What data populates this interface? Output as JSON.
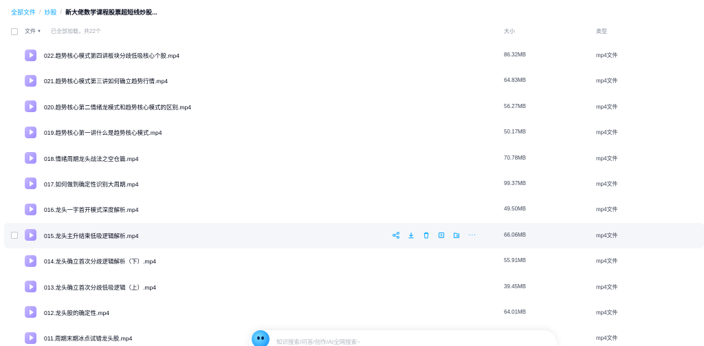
{
  "breadcrumb": {
    "items": [
      "全部文件",
      "炒股"
    ],
    "current": "新大佬数学课程股票超短线炒股...",
    "separator": "/"
  },
  "header": {
    "name_label": "文件",
    "loaded_text": "已全部加载，共22个",
    "size_label": "大小",
    "type_label": "类型"
  },
  "files": [
    {
      "name": "022.趋势核心模式第四讲板块分歧低吸核心个股.mp4",
      "size": "86.32MB",
      "type": "mp4文件"
    },
    {
      "name": "021.趋势核心模式第三讲如何确立趋势行情.mp4",
      "size": "64.83MB",
      "type": "mp4文件"
    },
    {
      "name": "020.趋势核心第二情绪龙模式和趋势核心模式的区别.mp4",
      "size": "56.27MB",
      "type": "mp4文件"
    },
    {
      "name": "019.趋势核心第一讲什么是趋势核心模式.mp4",
      "size": "50.17MB",
      "type": "mp4文件"
    },
    {
      "name": "018.情绪周期龙头战法之空仓篇.mp4",
      "size": "70.78MB",
      "type": "mp4文件"
    },
    {
      "name": "017.如何做到确定性识别大周期.mp4",
      "size": "99.37MB",
      "type": "mp4文件"
    },
    {
      "name": "016.龙头一字首开模式深度解析.mp4",
      "size": "49.50MB",
      "type": "mp4文件"
    },
    {
      "name": "015.龙头主升结束低吸逻辑解析.mp4",
      "size": "66.06MB",
      "type": "mp4文件"
    },
    {
      "name": "014.龙头确立首次分歧逻辑解析（下）.mp4",
      "size": "55.91MB",
      "type": "mp4文件"
    },
    {
      "name": "013.龙头确立首次分歧低吸逻辑（上）.mp4",
      "size": "39.45MB",
      "type": "mp4文件"
    },
    {
      "name": "012.龙头股的确定性.mp4",
      "size": "64.01MB",
      "type": "mp4文件"
    },
    {
      "name": "011.周期末期冰点试错龙头股.mp4",
      "size": "",
      "type": "mp4文件"
    }
  ],
  "hover_row_index": 7,
  "row_actions": [
    "share-icon",
    "download-icon",
    "delete-icon",
    "copy-icon",
    "move-icon",
    "more-icon"
  ],
  "ai_search": {
    "placeholder": "知识搜索/问答/创作/AI全网搜索~"
  },
  "colors": {
    "accent": "#06a7ff",
    "video_icon": "#a994ff",
    "text": "#03081a",
    "muted": "#818999"
  }
}
